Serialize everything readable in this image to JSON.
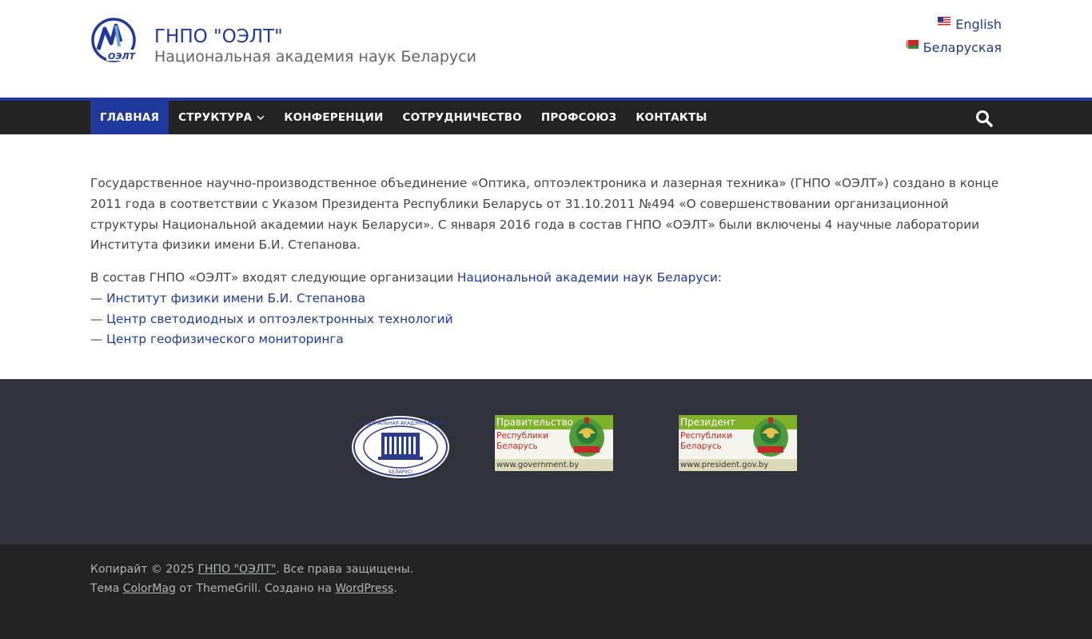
{
  "header": {
    "site_title": "ГНПО \"ОЭЛТ\"",
    "site_description": "Национальная академия наук Беларуси",
    "logo_text": "ОЭЛТ",
    "languages": [
      {
        "label": "English",
        "flag": "us-flag-icon"
      },
      {
        "label": "Беларуская",
        "flag": "by-flag-icon"
      }
    ]
  },
  "nav": {
    "items": [
      {
        "label": "ГЛАВНАЯ",
        "active": true
      },
      {
        "label": "СТРУКТУРА",
        "has_submenu": true
      },
      {
        "label": "КОНФЕРЕНЦИИ"
      },
      {
        "label": "СОТРУДНИЧЕСТВО"
      },
      {
        "label": "ПРОФСОЮЗ"
      },
      {
        "label": "КОНТАКТЫ"
      }
    ],
    "search_icon": "search-icon"
  },
  "content": {
    "intro": "Государственное научно-производственное объединение «Оптика, оптоэлектроника и лазерная техника» (ГНПО «ОЭЛТ») создано в конце 2011 года в соответствии с Указом Президента Республики Беларусь от 31.10.2011 №494 «О совершенствовании организационной структуры Национальной академии наук Беларуси». С января 2016 года в состав ГНПО «ОЭЛТ» были включены 4 научные лаборатории Института физики имени Б.И. Степанова.",
    "orgs_prefix": "В состав ГНПО «ОЭЛТ» входят следующие организации ",
    "orgs_link": "Национальной академии наук Беларуси",
    "orgs_suffix": ":",
    "dash": "— ",
    "org_links": [
      "Институт физики имени Б.И. Степанова",
      "Центр светодиодных и оптоэлектронных технологий",
      "Центр геофизического мониторинга"
    ]
  },
  "footer": {
    "nas_logo_top": "НАЦЫЯНАЛЬНАЯ АКАДЭМІЯ НАВУК",
    "nas_logo_bottom": "БЕЛАРУСІ",
    "banners": [
      {
        "top": "Правительство",
        "line1": "Республики",
        "line2": "Беларусь",
        "url": "www.government.by"
      },
      {
        "top": "Президент",
        "line1": "Республики",
        "line2": "Беларусь",
        "url": "www.president.gov.by"
      }
    ],
    "copyright_prefix": "Копирайт © 2025 ",
    "copyright_link": "ГНПО \"ОЭЛТ\"",
    "copyright_suffix": ". Все права защищены.",
    "theme_prefix": "Тема ",
    "theme_link": "ColorMag",
    "theme_mid": " от ThemeGrill. Создано на ",
    "wp_link": "WordPress",
    "theme_suffix": "."
  },
  "colors": {
    "primary": "#20399a",
    "nav_bg": "#232323",
    "footer_widgets_bg": "#2f323b",
    "footer_bg": "#232323"
  }
}
